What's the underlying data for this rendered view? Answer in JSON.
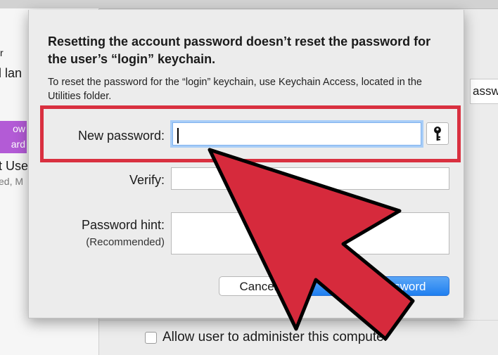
{
  "background": {
    "sidebar": {
      "text_fragments": [
        "r",
        "l lan",
        "t Use",
        "ed, M"
      ],
      "selected_item": [
        "ow",
        "ard"
      ]
    },
    "right_field_fragment": "asswo",
    "admin_checkbox_label": "Allow user to administer this computer",
    "admin_checkbox_checked": false
  },
  "dialog": {
    "heading": "Resetting the account password doesn’t reset the password for the user’s “login” keychain.",
    "subtext": "To reset the password for the “login” keychain, use Keychain Access, located in the Utilities folder.",
    "fields": {
      "new_password_label": "New password:",
      "new_password_value": "",
      "verify_label": "Verify:",
      "verify_value": "",
      "hint_label": "Password hint:",
      "hint_sublabel": "(Recommended)",
      "hint_value": ""
    },
    "key_icon": "key-icon",
    "buttons": {
      "cancel": "Cancel",
      "change_password": "Change Password"
    }
  },
  "annotation": {
    "highlight_color": "#d93040",
    "arrow_color": "#d62a3c",
    "arrow_icon": "pointer-arrow-icon"
  }
}
